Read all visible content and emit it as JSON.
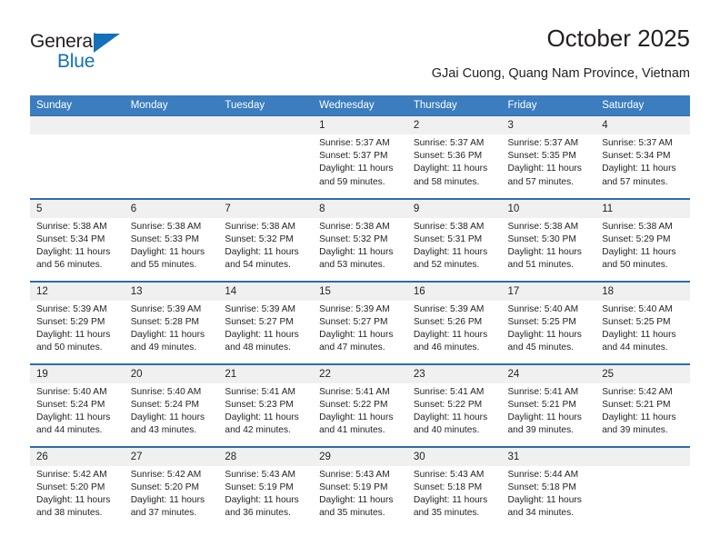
{
  "brand": {
    "name_part1": "General",
    "name_part2": "Blue",
    "accent_color": "#1271b8"
  },
  "header": {
    "title": "October 2025",
    "subtitle": "GJai Cuong, Quang Nam Province, Vietnam"
  },
  "calendar": {
    "header_bg": "#3b7dbf",
    "daynum_bg": "#f0f0f0",
    "row_border": "#2e6da8",
    "weekday_headers": [
      "Sunday",
      "Monday",
      "Tuesday",
      "Wednesday",
      "Thursday",
      "Friday",
      "Saturday"
    ],
    "weeks": [
      [
        {
          "day": "",
          "empty": true
        },
        {
          "day": "",
          "empty": true
        },
        {
          "day": "",
          "empty": true
        },
        {
          "day": "1",
          "sunrise": "Sunrise: 5:37 AM",
          "sunset": "Sunset: 5:37 PM",
          "daylight1": "Daylight: 11 hours",
          "daylight2": "and 59 minutes."
        },
        {
          "day": "2",
          "sunrise": "Sunrise: 5:37 AM",
          "sunset": "Sunset: 5:36 PM",
          "daylight1": "Daylight: 11 hours",
          "daylight2": "and 58 minutes."
        },
        {
          "day": "3",
          "sunrise": "Sunrise: 5:37 AM",
          "sunset": "Sunset: 5:35 PM",
          "daylight1": "Daylight: 11 hours",
          "daylight2": "and 57 minutes."
        },
        {
          "day": "4",
          "sunrise": "Sunrise: 5:37 AM",
          "sunset": "Sunset: 5:34 PM",
          "daylight1": "Daylight: 11 hours",
          "daylight2": "and 57 minutes."
        }
      ],
      [
        {
          "day": "5",
          "sunrise": "Sunrise: 5:38 AM",
          "sunset": "Sunset: 5:34 PM",
          "daylight1": "Daylight: 11 hours",
          "daylight2": "and 56 minutes."
        },
        {
          "day": "6",
          "sunrise": "Sunrise: 5:38 AM",
          "sunset": "Sunset: 5:33 PM",
          "daylight1": "Daylight: 11 hours",
          "daylight2": "and 55 minutes."
        },
        {
          "day": "7",
          "sunrise": "Sunrise: 5:38 AM",
          "sunset": "Sunset: 5:32 PM",
          "daylight1": "Daylight: 11 hours",
          "daylight2": "and 54 minutes."
        },
        {
          "day": "8",
          "sunrise": "Sunrise: 5:38 AM",
          "sunset": "Sunset: 5:32 PM",
          "daylight1": "Daylight: 11 hours",
          "daylight2": "and 53 minutes."
        },
        {
          "day": "9",
          "sunrise": "Sunrise: 5:38 AM",
          "sunset": "Sunset: 5:31 PM",
          "daylight1": "Daylight: 11 hours",
          "daylight2": "and 52 minutes."
        },
        {
          "day": "10",
          "sunrise": "Sunrise: 5:38 AM",
          "sunset": "Sunset: 5:30 PM",
          "daylight1": "Daylight: 11 hours",
          "daylight2": "and 51 minutes."
        },
        {
          "day": "11",
          "sunrise": "Sunrise: 5:38 AM",
          "sunset": "Sunset: 5:29 PM",
          "daylight1": "Daylight: 11 hours",
          "daylight2": "and 50 minutes."
        }
      ],
      [
        {
          "day": "12",
          "sunrise": "Sunrise: 5:39 AM",
          "sunset": "Sunset: 5:29 PM",
          "daylight1": "Daylight: 11 hours",
          "daylight2": "and 50 minutes."
        },
        {
          "day": "13",
          "sunrise": "Sunrise: 5:39 AM",
          "sunset": "Sunset: 5:28 PM",
          "daylight1": "Daylight: 11 hours",
          "daylight2": "and 49 minutes."
        },
        {
          "day": "14",
          "sunrise": "Sunrise: 5:39 AM",
          "sunset": "Sunset: 5:27 PM",
          "daylight1": "Daylight: 11 hours",
          "daylight2": "and 48 minutes."
        },
        {
          "day": "15",
          "sunrise": "Sunrise: 5:39 AM",
          "sunset": "Sunset: 5:27 PM",
          "daylight1": "Daylight: 11 hours",
          "daylight2": "and 47 minutes."
        },
        {
          "day": "16",
          "sunrise": "Sunrise: 5:39 AM",
          "sunset": "Sunset: 5:26 PM",
          "daylight1": "Daylight: 11 hours",
          "daylight2": "and 46 minutes."
        },
        {
          "day": "17",
          "sunrise": "Sunrise: 5:40 AM",
          "sunset": "Sunset: 5:25 PM",
          "daylight1": "Daylight: 11 hours",
          "daylight2": "and 45 minutes."
        },
        {
          "day": "18",
          "sunrise": "Sunrise: 5:40 AM",
          "sunset": "Sunset: 5:25 PM",
          "daylight1": "Daylight: 11 hours",
          "daylight2": "and 44 minutes."
        }
      ],
      [
        {
          "day": "19",
          "sunrise": "Sunrise: 5:40 AM",
          "sunset": "Sunset: 5:24 PM",
          "daylight1": "Daylight: 11 hours",
          "daylight2": "and 44 minutes."
        },
        {
          "day": "20",
          "sunrise": "Sunrise: 5:40 AM",
          "sunset": "Sunset: 5:24 PM",
          "daylight1": "Daylight: 11 hours",
          "daylight2": "and 43 minutes."
        },
        {
          "day": "21",
          "sunrise": "Sunrise: 5:41 AM",
          "sunset": "Sunset: 5:23 PM",
          "daylight1": "Daylight: 11 hours",
          "daylight2": "and 42 minutes."
        },
        {
          "day": "22",
          "sunrise": "Sunrise: 5:41 AM",
          "sunset": "Sunset: 5:22 PM",
          "daylight1": "Daylight: 11 hours",
          "daylight2": "and 41 minutes."
        },
        {
          "day": "23",
          "sunrise": "Sunrise: 5:41 AM",
          "sunset": "Sunset: 5:22 PM",
          "daylight1": "Daylight: 11 hours",
          "daylight2": "and 40 minutes."
        },
        {
          "day": "24",
          "sunrise": "Sunrise: 5:41 AM",
          "sunset": "Sunset: 5:21 PM",
          "daylight1": "Daylight: 11 hours",
          "daylight2": "and 39 minutes."
        },
        {
          "day": "25",
          "sunrise": "Sunrise: 5:42 AM",
          "sunset": "Sunset: 5:21 PM",
          "daylight1": "Daylight: 11 hours",
          "daylight2": "and 39 minutes."
        }
      ],
      [
        {
          "day": "26",
          "sunrise": "Sunrise: 5:42 AM",
          "sunset": "Sunset: 5:20 PM",
          "daylight1": "Daylight: 11 hours",
          "daylight2": "and 38 minutes."
        },
        {
          "day": "27",
          "sunrise": "Sunrise: 5:42 AM",
          "sunset": "Sunset: 5:20 PM",
          "daylight1": "Daylight: 11 hours",
          "daylight2": "and 37 minutes."
        },
        {
          "day": "28",
          "sunrise": "Sunrise: 5:43 AM",
          "sunset": "Sunset: 5:19 PM",
          "daylight1": "Daylight: 11 hours",
          "daylight2": "and 36 minutes."
        },
        {
          "day": "29",
          "sunrise": "Sunrise: 5:43 AM",
          "sunset": "Sunset: 5:19 PM",
          "daylight1": "Daylight: 11 hours",
          "daylight2": "and 35 minutes."
        },
        {
          "day": "30",
          "sunrise": "Sunrise: 5:43 AM",
          "sunset": "Sunset: 5:18 PM",
          "daylight1": "Daylight: 11 hours",
          "daylight2": "and 35 minutes."
        },
        {
          "day": "31",
          "sunrise": "Sunrise: 5:44 AM",
          "sunset": "Sunset: 5:18 PM",
          "daylight1": "Daylight: 11 hours",
          "daylight2": "and 34 minutes."
        },
        {
          "day": "",
          "empty": true
        }
      ]
    ]
  }
}
